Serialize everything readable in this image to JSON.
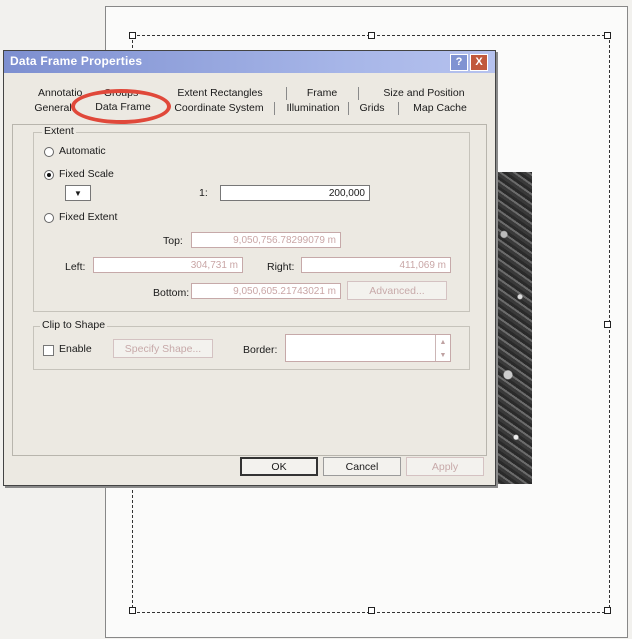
{
  "dialog": {
    "title": "Data Frame Properties",
    "help_label": "?",
    "close_label": "X"
  },
  "tabs_row_top": [
    {
      "label": "Annotatio"
    },
    {
      "label": "Groups"
    },
    {
      "label": "Extent Rectangles"
    },
    {
      "label": "Frame"
    },
    {
      "label": "Size and Position"
    }
  ],
  "tabs_row_bottom": [
    {
      "label": "General"
    },
    {
      "label": "Data Frame"
    },
    {
      "label": "Coordinate System"
    },
    {
      "label": "Illumination"
    },
    {
      "label": "Grids"
    },
    {
      "label": "Map Cache"
    }
  ],
  "extent": {
    "group_label": "Extent",
    "automatic_label": "Automatic",
    "fixed_scale_label": "Fixed Scale",
    "scale_prefix": "1:",
    "scale_value": "200,000",
    "fixed_extent_label": "Fixed Extent",
    "top_label": "Top:",
    "top_value": "9,050,756.78299079 m",
    "left_label": "Left:",
    "left_value": "304,731 m",
    "right_label": "Right:",
    "right_value": "411,069 m",
    "bottom_label": "Bottom:",
    "bottom_value": "9,050,605.21743021 m",
    "advanced_label": "Advanced..."
  },
  "clip": {
    "group_label": "Clip to Shape",
    "enable_label": "Enable",
    "specify_shape_label": "Specify Shape...",
    "border_label": "Border:"
  },
  "footer": {
    "ok_label": "OK",
    "cancel_label": "Cancel",
    "apply_label": "Apply"
  },
  "colors": {
    "highlight_circle": "#e0483a",
    "titlebar": "#7d8fd0"
  }
}
